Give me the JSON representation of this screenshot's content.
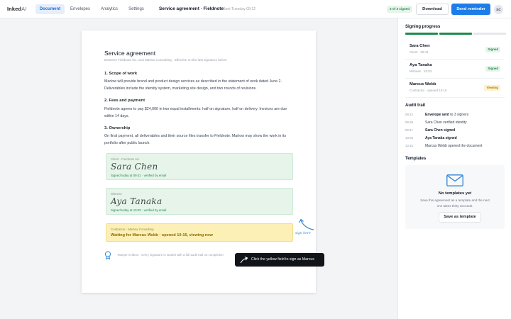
{
  "app": {
    "logo_main": "Inked",
    "logo_suffix": "AI"
  },
  "nav": {
    "tabs": [
      {
        "label": "Document",
        "active": true
      },
      {
        "label": "Envelopes",
        "active": false
      },
      {
        "label": "Analytics",
        "active": false
      },
      {
        "label": "Settings",
        "active": false
      }
    ]
  },
  "header": {
    "title": "Service agreement · Fieldnote",
    "sent": "Sent Tuesday 09:12",
    "status_pill": "2 of 3 signed",
    "download_label": "Download",
    "remind_label": "Send reminder",
    "avatar_initials": "SC"
  },
  "document": {
    "title": "Service agreement",
    "subtitle": "Between Fieldnote Inc. and Marlow Consulting · Effective on the last signature below",
    "sections": [
      {
        "heading": "1. Scope of work",
        "body": "Marlow will provide brand and product design services as described in the statement of work dated June 2. Deliverables include the identity system, marketing site design, and two rounds of revisions."
      },
      {
        "heading": "2. Fees and payment",
        "body": "Fieldnote agrees to pay $24,000 in two equal installments: half on signature, half on delivery. Invoices are due within 14 days."
      },
      {
        "heading": "3. Ownership",
        "body": "On final payment, all deliverables and their source files transfer to Fieldnote. Marlow may show the work in its portfolio after public launch."
      }
    ],
    "signatures": [
      {
        "role": "Client · Fieldnote Inc.",
        "script": "Sara Chen",
        "meta": "Signed today at 09:41 · verified by email"
      },
      {
        "role": "Witness",
        "script": "Aya Tanaka",
        "meta": "Signed today at 10:03 · verified by email"
      }
    ],
    "pending": {
      "role": "Contractor · Marlow Consulting",
      "text": "Waiting for Marcus Webb · opened 10:15, viewing now"
    },
    "arrow_note": "sign here",
    "footnote": "Tamper-evident · every signature is sealed with a full audit trail on completion"
  },
  "toast": {
    "text": "Click the yellow field to sign as Marcus"
  },
  "panel": {
    "progress_title": "Signing progress",
    "progress": [
      1,
      1,
      0
    ],
    "signers": [
      {
        "name": "Sara Chen",
        "role": "Client · 09:41",
        "status": "Signed",
        "status_type": "signed"
      },
      {
        "name": "Aya Tanaka",
        "role": "Witness · 10:03",
        "status": "Signed",
        "status_type": "signed"
      },
      {
        "name": "Marcus Webb",
        "role": "Contractor · opened 10:15",
        "status": "Viewing",
        "status_type": "viewing"
      }
    ],
    "audit_title": "Audit trail",
    "audit": [
      {
        "time": "09:12",
        "bold": "Envelope sent",
        "rest": " to 3 signers"
      },
      {
        "time": "09:39",
        "bold": "",
        "rest": "Sara Chen verified identity"
      },
      {
        "time": "09:41",
        "bold": "Sara Chen signed",
        "rest": ""
      },
      {
        "time": "10:03",
        "bold": "Aya Tanaka signed",
        "rest": ""
      },
      {
        "time": "10:15",
        "bold": "",
        "rest": "Marcus Webb opened the document"
      }
    ],
    "templates_title": "Templates",
    "templates_empty_title": "No templates yet",
    "templates_empty_body": "Save this agreement as a template and the next one takes thirty seconds.",
    "templates_button": "Save as template"
  }
}
